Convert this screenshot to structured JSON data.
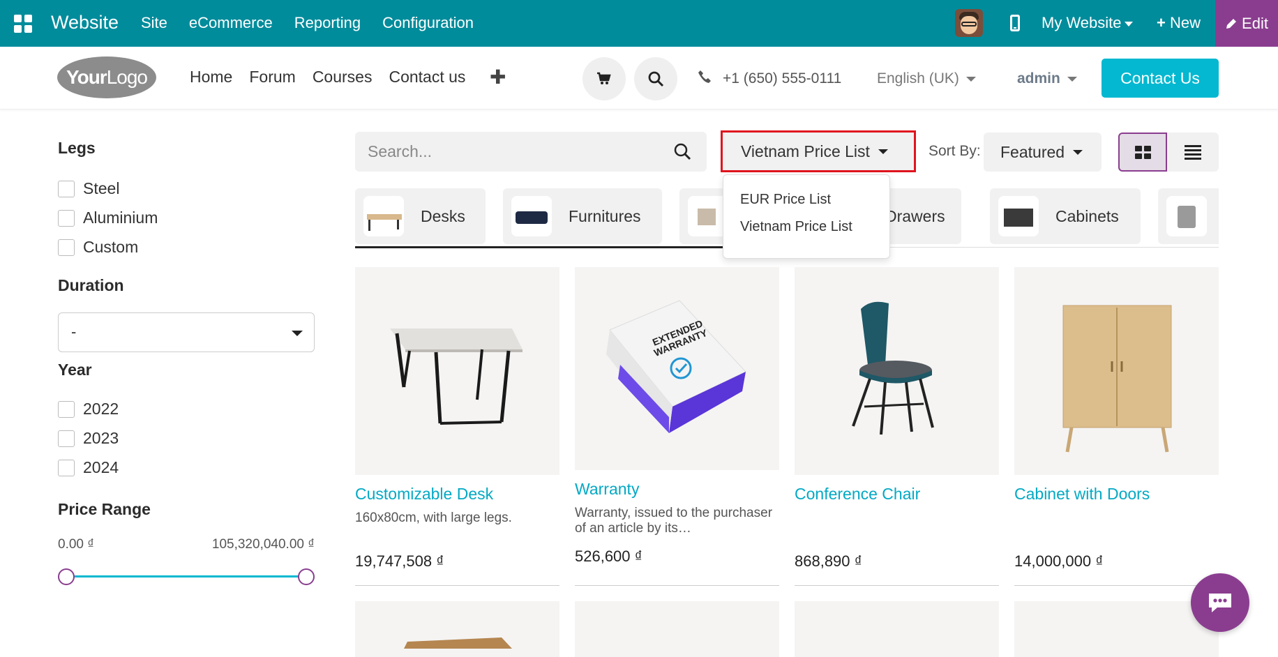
{
  "topbar": {
    "brand": "Website",
    "menu": [
      "Site",
      "eCommerce",
      "Reporting",
      "Configuration"
    ],
    "my_website": "My Website",
    "new_label": "New",
    "edit_label": "Edit",
    "bg_color": "#018c9c",
    "edit_color": "#8a3d8f"
  },
  "header": {
    "logo_bold": "Your",
    "logo_light": "Logo",
    "nav": [
      "Home",
      "Forum",
      "Courses",
      "Contact us"
    ],
    "phone": "+1 (650) 555-0111",
    "language": "English (UK)",
    "user": "admin",
    "contact_button": "Contact Us"
  },
  "filters": {
    "legs": {
      "title": "Legs",
      "options": [
        "Steel",
        "Aluminium",
        "Custom"
      ]
    },
    "duration": {
      "title": "Duration",
      "value": "-"
    },
    "year": {
      "title": "Year",
      "options": [
        "2022",
        "2023",
        "2024"
      ]
    },
    "price_range": {
      "title": "Price Range",
      "min": "0.00 ₫",
      "max": "105,320,040.00 ₫"
    }
  },
  "toolbar": {
    "search_placeholder": "Search...",
    "pricelist": "Vietnam Price List",
    "sort_label": "Sort By:",
    "sort_value": "Featured"
  },
  "pricelist_dropdown": [
    "EUR Price List",
    "Vietnam Price List"
  ],
  "categories": [
    "Desks",
    "Furnitures",
    "Drawers",
    "Cabinets"
  ],
  "products": [
    {
      "name": "Customizable Desk",
      "description": "160x80cm, with large legs.",
      "price": "19,747,508 ₫"
    },
    {
      "name": "Warranty",
      "description": "Warranty, issued to the purchaser of an article by its…",
      "price": "526,600 ₫"
    },
    {
      "name": "Conference Chair",
      "description": "",
      "price": "868,890 ₫"
    },
    {
      "name": "Cabinet with Doors",
      "description": "",
      "price": "14,000,000 ₫"
    }
  ],
  "warranty_box_text": [
    "EXTENDED",
    "WARRANTY"
  ]
}
